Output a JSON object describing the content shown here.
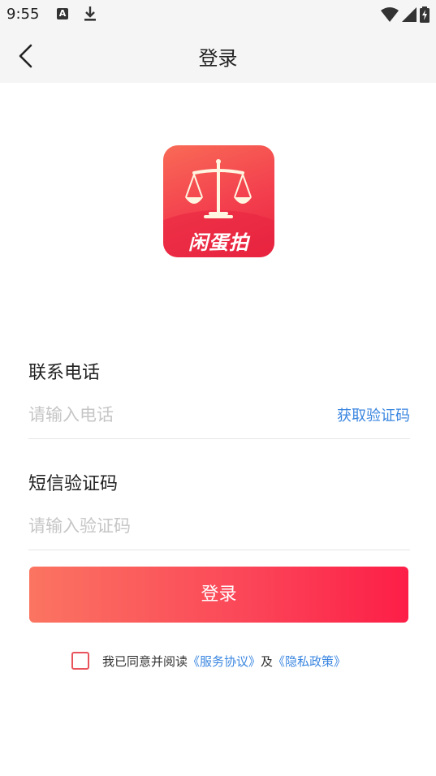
{
  "status_bar": {
    "time": "9:55",
    "notification_icon_letter": "A",
    "icons": [
      "a-notification-icon",
      "download-icon",
      "wifi-icon",
      "signal-icon",
      "battery-charging-icon"
    ]
  },
  "nav": {
    "title": "登录",
    "back_icon": "chevron-left-icon"
  },
  "logo": {
    "text": "闲蛋拍",
    "icon": "balance-scale-icon",
    "colors": {
      "start": "#f96a56",
      "end": "#e8233f"
    }
  },
  "form": {
    "phone": {
      "label": "联系电话",
      "placeholder": "请输入电话",
      "value": "",
      "get_code_label": "获取验证码"
    },
    "code": {
      "label": "短信验证码",
      "placeholder": "请输入验证码",
      "value": ""
    },
    "submit_label": "登录"
  },
  "agreement": {
    "checked": false,
    "prefix": "我已同意并阅读",
    "service_link": "《服务协议》",
    "connector": "及",
    "privacy_link": "《隐私政策》"
  },
  "colors": {
    "accent_link": "#3a86e0",
    "button_start": "#fb7461",
    "button_end": "#fd1e47",
    "checkbox_border": "#e9535b"
  }
}
